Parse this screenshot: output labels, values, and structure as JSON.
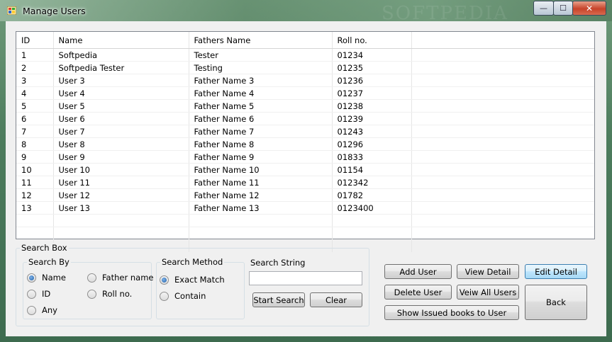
{
  "window": {
    "title": "Manage Users",
    "minimize": "—",
    "maximize": "☐",
    "close": "✕"
  },
  "grid": {
    "columns": [
      "ID",
      "Name",
      "Fathers Name",
      "Roll no."
    ],
    "rows": [
      [
        "1",
        "Softpedia",
        "Tester",
        "01234"
      ],
      [
        "2",
        "Softpedia Tester",
        "Testing",
        "01235"
      ],
      [
        "3",
        "User 3",
        "Father Name 3",
        "01236"
      ],
      [
        "4",
        "User 4",
        "Father Name 4",
        "01237"
      ],
      [
        "5",
        "User 5",
        "Father Name 5",
        "01238"
      ],
      [
        "6",
        "User 6",
        "Father Name 6",
        "01239"
      ],
      [
        "7",
        "User 7",
        "Father Name 7",
        "01243"
      ],
      [
        "8",
        "User 8",
        "Father Name 8",
        "01296"
      ],
      [
        "9",
        "User 9",
        "Father Name 9",
        "01833"
      ],
      [
        "10",
        "User 10",
        "Father Name 10",
        "01154"
      ],
      [
        "11",
        "User 11",
        "Father Name 11",
        "012342"
      ],
      [
        "12",
        "User 12",
        "Father Name 12",
        "01782"
      ],
      [
        "13",
        "User 13",
        "Father Name 13",
        "0123400"
      ]
    ]
  },
  "search_box": {
    "title": "Search Box",
    "search_by": {
      "title": "Search By",
      "options": [
        "Name",
        "ID",
        "Any",
        "Father name",
        "Roll no."
      ],
      "selected": "Name"
    },
    "search_method": {
      "title": "Search Method",
      "options": [
        "Exact Match",
        "Contain"
      ],
      "selected": "Exact Match"
    },
    "search_string": {
      "label": "Search String",
      "value": ""
    },
    "start_search": "Start Search",
    "clear": "Clear"
  },
  "actions": {
    "add_user": "Add User",
    "view_detail": "View Detail",
    "edit_detail": "Edit Detail",
    "delete_user": "Delete User",
    "view_all_users": "Veiw All Users",
    "show_issued_books": "Show Issued books to User",
    "back": "Back"
  }
}
